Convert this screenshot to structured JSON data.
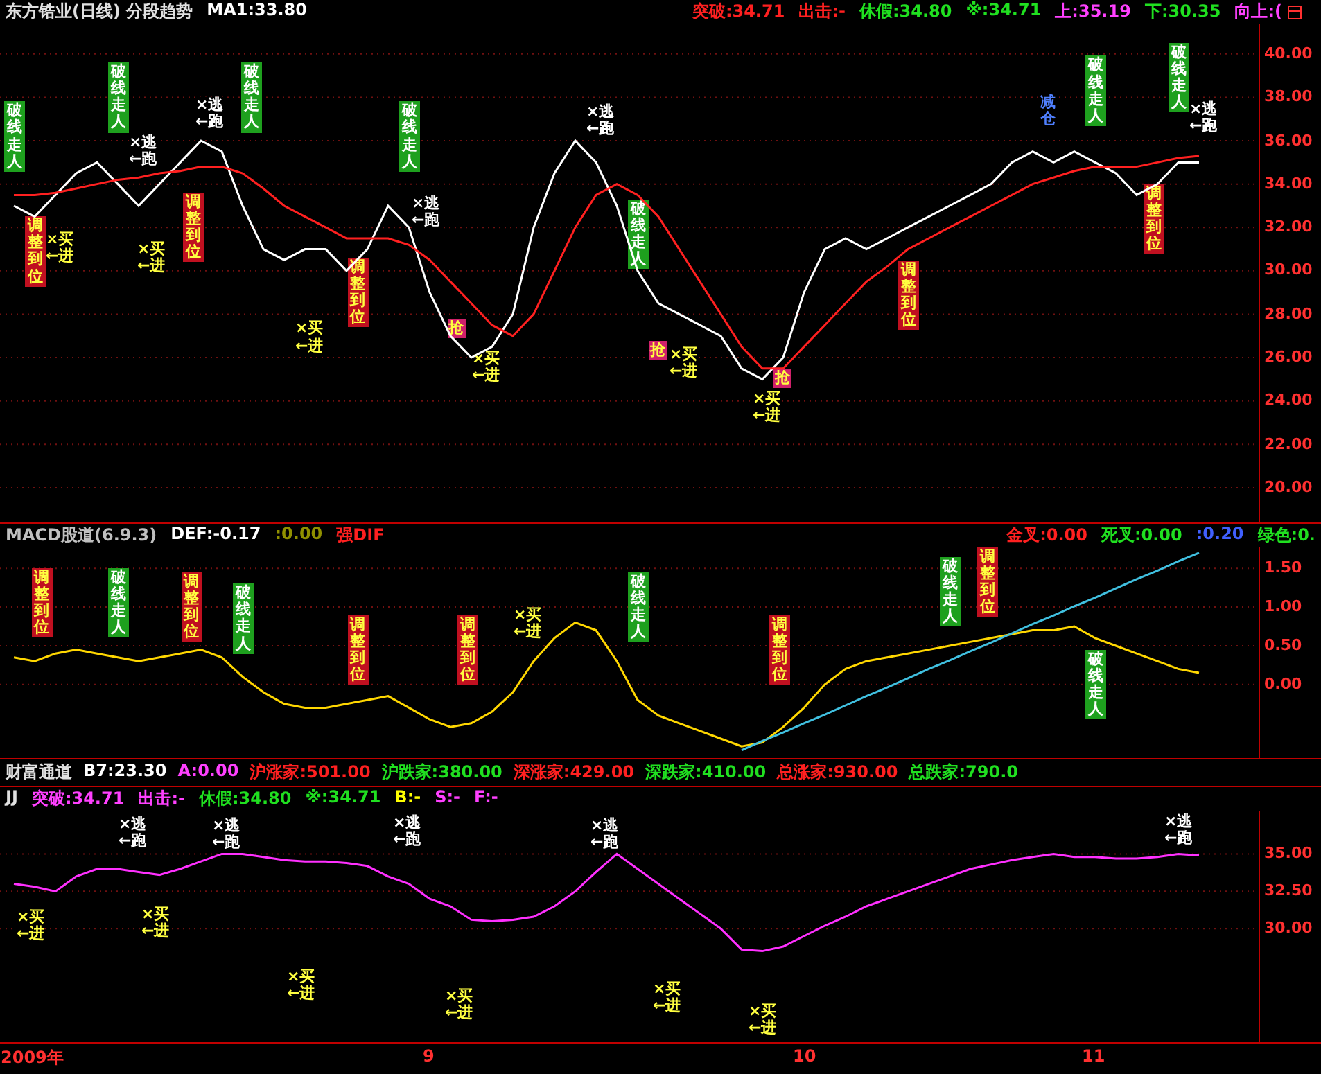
{
  "main_panel": {
    "header_left": [
      {
        "text": "东方锆业(日线) 分段趋势",
        "color": "#e0e0e0"
      },
      {
        "text": "MA1:33.80",
        "color": "#ffffff"
      }
    ],
    "header_right": [
      {
        "text": "突破:34.71",
        "color": "#ff2020"
      },
      {
        "text": "出击:-",
        "color": "#ff2020"
      },
      {
        "text": "休假:34.80",
        "color": "#20e020"
      },
      {
        "text": "※:34.71",
        "color": "#20e020"
      },
      {
        "text": "上:35.19",
        "color": "#ff40ff"
      },
      {
        "text": "下:30.35",
        "color": "#20e020"
      },
      {
        "text": "向上:(",
        "color": "#ff40ff"
      }
    ],
    "chart_data": {
      "type": "line",
      "grid": true,
      "ylim": [
        18.4,
        41.4
      ],
      "yticks": [
        {
          "value": 20,
          "label": "20.00"
        },
        {
          "value": 22,
          "label": "22.00"
        },
        {
          "value": 24,
          "label": "24.00"
        },
        {
          "value": 26,
          "label": "26.00"
        },
        {
          "value": 28,
          "label": "28.00"
        },
        {
          "value": 30,
          "label": "30.00"
        },
        {
          "value": 32,
          "label": "32.00"
        },
        {
          "value": 34,
          "label": "34.00"
        },
        {
          "value": 36,
          "label": "36.00"
        },
        {
          "value": 38,
          "label": "38.00"
        },
        {
          "value": 40,
          "label": "40.00"
        }
      ],
      "series": [
        {
          "color": "#ffffff",
          "values": [
            33,
            32.5,
            33.5,
            34.5,
            35,
            34,
            33,
            34,
            35,
            36,
            35.5,
            33,
            31,
            30.5,
            31,
            31,
            30,
            31,
            33,
            32,
            29,
            27,
            26,
            26.5,
            28,
            32,
            34.5,
            36,
            35,
            33,
            30,
            28.5,
            28,
            27.5,
            27,
            25.5,
            25,
            26,
            29,
            31,
            31.5,
            31,
            31.5,
            32,
            32.5,
            33,
            33.5,
            34,
            35,
            35.5,
            35,
            35.5,
            35,
            34.5,
            33.5,
            34,
            35,
            35
          ]
        },
        {
          "color": "#ff2020",
          "values": [
            33.5,
            33.5,
            33.6,
            33.8,
            34,
            34.2,
            34.3,
            34.5,
            34.6,
            34.8,
            34.8,
            34.5,
            33.8,
            33,
            32.5,
            32,
            31.5,
            31.5,
            31.5,
            31.2,
            30.5,
            29.5,
            28.5,
            27.5,
            27,
            28,
            30,
            32,
            33.5,
            34,
            33.5,
            32.5,
            31,
            29.5,
            28,
            26.5,
            25.5,
            25.5,
            26.5,
            27.5,
            28.5,
            29.5,
            30.2,
            31,
            31.5,
            32,
            32.5,
            33,
            33.5,
            34,
            34.3,
            34.6,
            34.8,
            34.8,
            34.8,
            35,
            35.2,
            35.3
          ]
        }
      ]
    },
    "signals": [
      {
        "kind": "break",
        "text": "破线走人"
      },
      {
        "kind": "adjust",
        "text": "调整到位"
      },
      {
        "kind": "buy",
        "text": "×买\n←进"
      },
      {
        "kind": "break",
        "text": "破线走人"
      },
      {
        "kind": "escape",
        "text": "×逃\n←跑"
      },
      {
        "kind": "buy",
        "text": "×买\n←进"
      },
      {
        "kind": "adjust",
        "text": "调整到位"
      },
      {
        "kind": "escape",
        "text": "×逃\n←跑"
      },
      {
        "kind": "break",
        "text": "破线走人"
      },
      {
        "kind": "buy",
        "text": "×买\n←进"
      },
      {
        "kind": "adjust",
        "text": "调整到位"
      },
      {
        "kind": "break",
        "text": "破线走人"
      },
      {
        "kind": "escape",
        "text": "×逃\n←跑"
      },
      {
        "kind": "grab",
        "text": "抢"
      },
      {
        "kind": "buy",
        "text": "×买\n←进"
      },
      {
        "kind": "escape",
        "text": "×逃\n←跑"
      },
      {
        "kind": "break",
        "text": "破线走人"
      },
      {
        "kind": "grab",
        "text": "抢"
      },
      {
        "kind": "buy",
        "text": "×买\n←进"
      },
      {
        "kind": "buy",
        "text": "×买\n←进"
      },
      {
        "kind": "grab",
        "text": "抢"
      },
      {
        "kind": "adjust",
        "text": "调整到位"
      },
      {
        "kind": "reduce",
        "text": "减仓"
      },
      {
        "kind": "break",
        "text": "破线走人"
      },
      {
        "kind": "adjust",
        "text": "调整到位"
      },
      {
        "kind": "break",
        "text": "破线走人"
      },
      {
        "kind": "escape",
        "text": "×逃\n←跑"
      }
    ]
  },
  "macd_panel": {
    "header_left": [
      {
        "text": "MACD股道(6.9.3)",
        "color": "#c0c0c0"
      },
      {
        "text": "DEF:-0.17",
        "color": "#ffffff"
      },
      {
        "text": ":0.00",
        "color": "#909000"
      },
      {
        "text": "强DIF",
        "color": "#ff2020"
      }
    ],
    "header_right": [
      {
        "text": "金叉:0.00",
        "color": "#ff2020"
      },
      {
        "text": "死叉:0.00",
        "color": "#20e020"
      },
      {
        "text": ":0.20",
        "color": "#4060ff"
      },
      {
        "text": "绿色:0.",
        "color": "#20e020"
      }
    ],
    "chart_data": {
      "type": "line",
      "grid": true,
      "ylim": [
        -0.95,
        1.77
      ],
      "yticks": [
        {
          "value": 0,
          "label": "0.00"
        },
        {
          "value": 0.5,
          "label": "0.50"
        },
        {
          "value": 1,
          "label": "1.00"
        },
        {
          "value": 1.5,
          "label": "1.50"
        }
      ],
      "series": [
        {
          "color": "#ffd700",
          "values": [
            0.35,
            0.3,
            0.4,
            0.45,
            0.4,
            0.35,
            0.3,
            0.35,
            0.4,
            0.45,
            0.35,
            0.1,
            -0.1,
            -0.25,
            -0.3,
            -0.3,
            -0.25,
            -0.2,
            -0.15,
            -0.3,
            -0.45,
            -0.55,
            -0.5,
            -0.35,
            -0.1,
            0.3,
            0.6,
            0.8,
            0.7,
            0.3,
            -0.2,
            -0.4,
            -0.5,
            -0.6,
            -0.7,
            -0.8,
            -0.75,
            -0.55,
            -0.3,
            0,
            0.2,
            0.3,
            0.35,
            0.4,
            0.45,
            0.5,
            0.55,
            0.6,
            0.65,
            0.7,
            0.7,
            0.75,
            0.6,
            0.5,
            0.4,
            0.3,
            0.2,
            0.15
          ]
        },
        {
          "color": "#40c0e0",
          "values": [
            null,
            null,
            null,
            null,
            null,
            null,
            null,
            null,
            null,
            null,
            null,
            null,
            null,
            null,
            null,
            null,
            null,
            null,
            null,
            null,
            null,
            null,
            null,
            null,
            null,
            null,
            null,
            null,
            null,
            null,
            null,
            null,
            null,
            null,
            null,
            -0.85,
            -0.73,
            -0.62,
            -0.5,
            -0.39,
            -0.27,
            -0.15,
            -0.04,
            0.08,
            0.2,
            0.31,
            0.43,
            0.54,
            0.66,
            0.78,
            0.89,
            1.01,
            1.12,
            1.24,
            1.36,
            1.47,
            1.59,
            1.7
          ]
        }
      ]
    },
    "signals": [
      {
        "kind": "adjust",
        "text": "调整到位"
      },
      {
        "kind": "break",
        "text": "破线走人"
      },
      {
        "kind": "adjust",
        "text": "调整到位"
      },
      {
        "kind": "break",
        "text": "破线走人"
      },
      {
        "kind": "adjust",
        "text": "调整到位"
      },
      {
        "kind": "adjust",
        "text": "调整到位"
      },
      {
        "kind": "buy",
        "text": "×买\n←进"
      },
      {
        "kind": "break",
        "text": "破线走人"
      },
      {
        "kind": "adjust",
        "text": "调整到位"
      },
      {
        "kind": "break",
        "text": "破线走人"
      },
      {
        "kind": "adjust",
        "text": "调整到位"
      },
      {
        "kind": "break",
        "text": "破线走人"
      }
    ]
  },
  "market_bar": [
    {
      "text": "财富通道",
      "color": "#e0e0e0"
    },
    {
      "text": "B7:23.30",
      "color": "#ffffff"
    },
    {
      "text": "A:0.00",
      "color": "#ff40ff"
    },
    {
      "text": "沪涨家:501.00",
      "color": "#ff2020"
    },
    {
      "text": "沪跌家:380.00",
      "color": "#20e020"
    },
    {
      "text": "深涨家:429.00",
      "color": "#ff2020"
    },
    {
      "text": "深跌家:410.00",
      "color": "#20e020"
    },
    {
      "text": "总涨家:930.00",
      "color": "#ff2020"
    },
    {
      "text": "总跌家:790.0",
      "color": "#20e020"
    }
  ],
  "jj_panel": {
    "header_left": [
      {
        "text": "JJ",
        "color": "#e0e0e0"
      },
      {
        "text": "突破:34.71",
        "color": "#ff40ff"
      },
      {
        "text": "出击:-",
        "color": "#ff40ff"
      },
      {
        "text": "休假:34.80",
        "color": "#20e020"
      },
      {
        "text": "※:34.71",
        "color": "#20e020"
      },
      {
        "text": "B:-",
        "color": "#ffff00"
      },
      {
        "text": "S:-",
        "color": "#ff40ff"
      },
      {
        "text": "F:-",
        "color": "#ff40ff"
      }
    ],
    "chart_data": {
      "type": "line",
      "grid": true,
      "ylim": [
        22.4,
        37.9
      ],
      "yticks": [
        {
          "value": 30,
          "label": "30.00"
        },
        {
          "value": 32.5,
          "label": "32.50"
        },
        {
          "value": 35,
          "label": "35.00"
        }
      ],
      "series": [
        {
          "color": "#ff30ff",
          "values": [
            33,
            32.8,
            32.5,
            33.5,
            34,
            34,
            33.8,
            33.6,
            34,
            34.5,
            35,
            35,
            34.8,
            34.6,
            34.5,
            34.5,
            34.4,
            34.2,
            33.5,
            33,
            32,
            31.5,
            30.6,
            30.5,
            30.6,
            30.8,
            31.5,
            32.5,
            33.8,
            35,
            34,
            33,
            32,
            31,
            30,
            28.6,
            28.5,
            28.8,
            29.5,
            30.2,
            30.8,
            31.5,
            32,
            32.5,
            33,
            33.5,
            34,
            34.3,
            34.6,
            34.8,
            35,
            34.8,
            34.8,
            34.7,
            34.7,
            34.8,
            35,
            34.9
          ]
        }
      ]
    },
    "signals": [
      {
        "kind": "buy",
        "text": "×买\n←进"
      },
      {
        "kind": "escape",
        "text": "×逃\n←跑"
      },
      {
        "kind": "buy",
        "text": "×买\n←进"
      },
      {
        "kind": "escape",
        "text": "×逃\n←跑"
      },
      {
        "kind": "buy",
        "text": "×买\n←进"
      },
      {
        "kind": "escape",
        "text": "×逃\n←跑"
      },
      {
        "kind": "buy",
        "text": "×买\n←进"
      },
      {
        "kind": "escape",
        "text": "×逃\n←跑"
      },
      {
        "kind": "buy",
        "text": "×买\n←进"
      },
      {
        "kind": "buy",
        "text": "×买\n←进"
      },
      {
        "kind": "escape",
        "text": "×逃\n←跑"
      }
    ]
  },
  "date_axis": [
    "2009年",
    "9",
    "10",
    "11"
  ]
}
